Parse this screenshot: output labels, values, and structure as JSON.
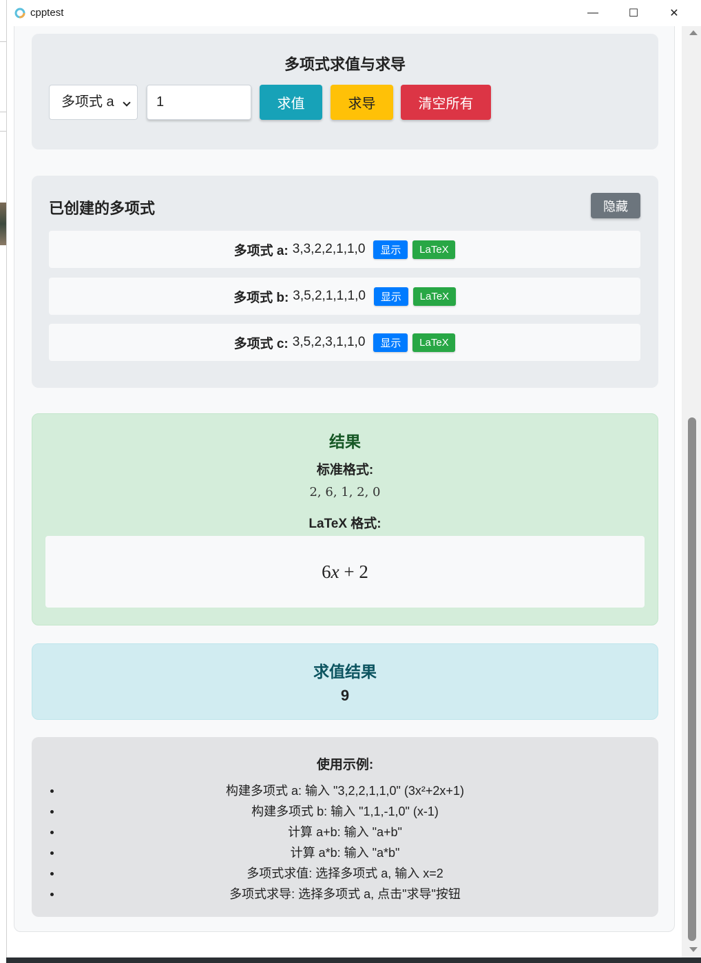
{
  "window": {
    "title": "cpptest",
    "controls": {
      "minimize": "—",
      "maximize": "☐",
      "close": "✕"
    }
  },
  "eval_section": {
    "title": "多项式求值与求导",
    "select_value": "多项式 a",
    "x_value": "1",
    "eval_button": "求值",
    "derive_button": "求导",
    "clear_button": "清空所有"
  },
  "poly_section": {
    "title": "已创建的多项式",
    "hide_button": "隐藏",
    "items": [
      {
        "name": "多项式 a:",
        "coeffs": "3,3,2,2,1,1,0",
        "show": "显示",
        "latex": "LaTeX"
      },
      {
        "name": "多项式 b:",
        "coeffs": "3,5,2,1,1,1,0",
        "show": "显示",
        "latex": "LaTeX"
      },
      {
        "name": "多项式 c:",
        "coeffs": "3,5,2,3,1,1,0",
        "show": "显示",
        "latex": "LaTeX"
      }
    ]
  },
  "result_section": {
    "title": "结果",
    "standard_label": "标准格式:",
    "standard_value": "2, 6, 1, 2, 0",
    "latex_label": "LaTeX 格式:",
    "latex_value": "6x + 2"
  },
  "eval_result_section": {
    "title": "求值结果",
    "value": "9"
  },
  "examples_section": {
    "title": "使用示例:",
    "items": [
      "构建多项式 a: 输入 \"3,2,2,1,1,0\" (3x²+2x+1)",
      "构建多项式 b: 输入 \"1,1,-1,0\" (x-1)",
      "计算 a+b: 输入 \"a+b\"",
      "计算 a*b: 输入 \"a*b\"",
      "多项式求值: 选择多项式 a, 输入 x=2",
      "多项式求导: 选择多项式 a, 点击\"求导\"按钮"
    ]
  },
  "colors": {
    "eval_button": "#17a2b8",
    "derive_button": "#ffc107",
    "clear_button": "#dc3545",
    "hide_button": "#6c757d",
    "show_button": "#007bff",
    "latex_button": "#28a745",
    "result_bg": "#d4edda",
    "eval_result_bg": "#d1ecf1"
  }
}
